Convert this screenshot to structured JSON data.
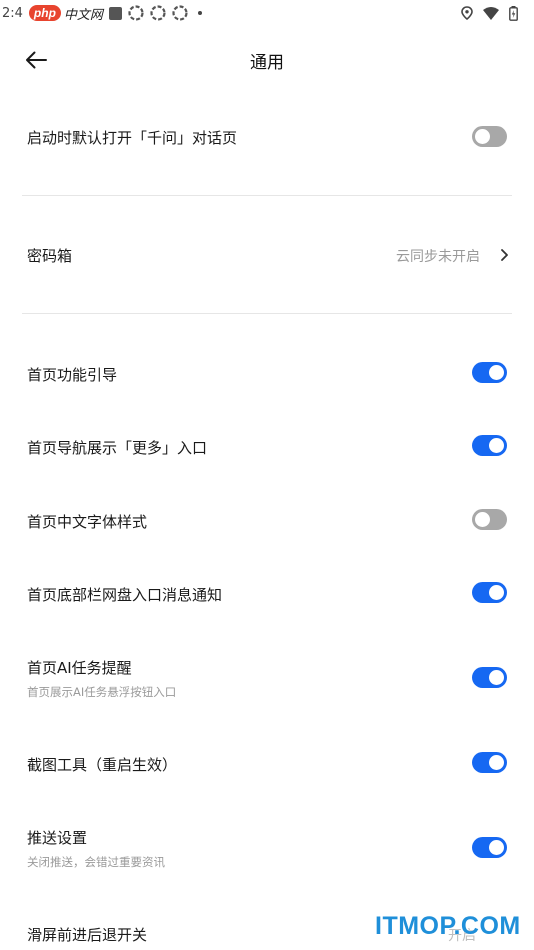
{
  "status_bar": {
    "time": "2:4",
    "watermark_php": "php",
    "watermark_cn": "中文网",
    "icons": [
      "notification-square-icon",
      "flower-icon",
      "flower-icon",
      "flower-icon",
      "dot-icon",
      "location-icon",
      "wifi-icon",
      "battery-icon"
    ]
  },
  "header": {
    "title": "通用",
    "back_icon": "arrow-left-icon"
  },
  "settings": {
    "open_qianwen_default": {
      "label": "启动时默认打开「千问」对话页",
      "enabled": false
    },
    "password_vault": {
      "label": "密码箱",
      "value": "云同步未开启"
    },
    "home_feature_guide": {
      "label": "首页功能引导",
      "enabled": true
    },
    "home_nav_more": {
      "label": "首页导航展示「更多」入口",
      "enabled": true
    },
    "home_cn_font": {
      "label": "首页中文字体样式",
      "enabled": false
    },
    "home_bottom_netdisk": {
      "label": "首页底部栏网盘入口消息通知",
      "enabled": true
    },
    "home_ai_task": {
      "label": "首页AI任务提醒",
      "sub": "首页展示AI任务悬浮按钮入口",
      "enabled": true
    },
    "screenshot_tool": {
      "label": "截图工具（重启生效）",
      "enabled": true
    },
    "push": {
      "label": "推送设置",
      "sub": "关闭推送，会错过重要资讯",
      "enabled": true
    },
    "swipe_nav": {
      "label": "滑屏前进后退开关",
      "value": "开启"
    }
  },
  "watermark_bottom": "ITMOP.COM",
  "colors": {
    "accent": "#1668f2",
    "toggle_off": "#a8a8a8",
    "text": "#1a1a1a",
    "secondary": "#9a9a9a"
  }
}
